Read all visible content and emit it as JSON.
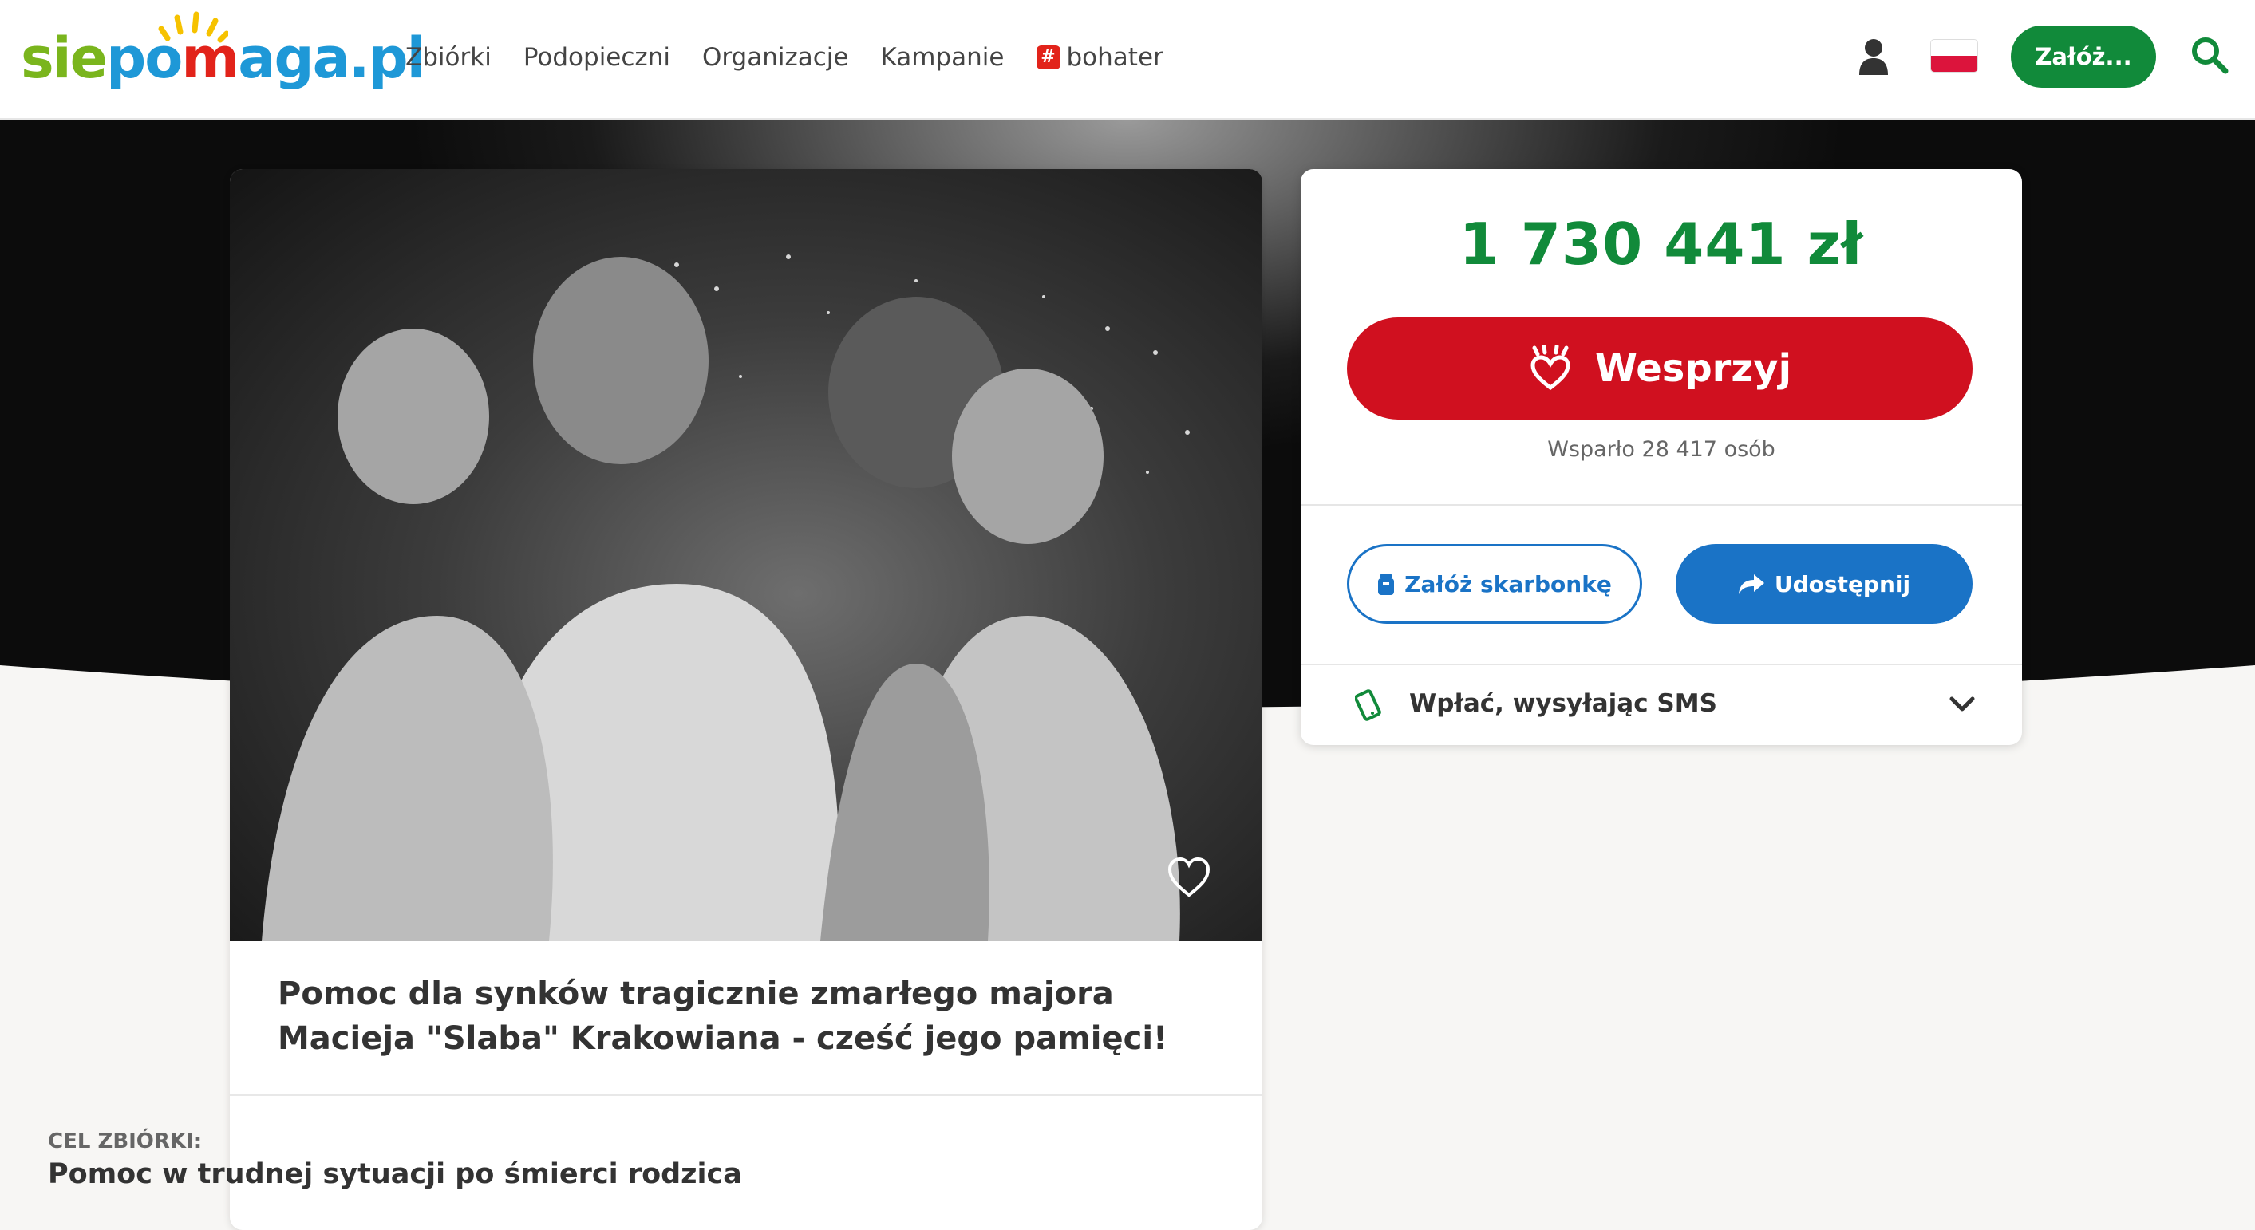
{
  "header": {
    "logo": {
      "sie": "sie",
      "po": "po",
      "heart": "m",
      "maga": "aga",
      "pl": ".pl"
    },
    "nav": [
      "Zbiórki",
      "Podopieczni",
      "Organizacje",
      "Kampanie"
    ],
    "nav_hashtag": {
      "badge": "#",
      "label": "bohater"
    },
    "cta_label": "Załóż...",
    "icons": [
      "user-icon",
      "poland-flag-icon",
      "search-icon"
    ]
  },
  "fundraiser": {
    "title": "Pomoc dla synków tragicznie zmarłego majora Macieja \"Slaba\" Krakowiana - cześć jego pamięci!",
    "goal_label": "CEL ZBIÓRKI:",
    "goal_value": "Pomoc w trudnej sytuacji po śmierci rodzica"
  },
  "donation": {
    "amount": "1 730 441 zł",
    "support_button": "Wesprzyj",
    "supporters": "Wsparło 28 417 osób",
    "piggybank_button": "Załóż skarbonkę",
    "share_button": "Udostępnij",
    "sms_label": "Wpłać, wysyłając SMS"
  },
  "colors": {
    "brand_green": "#118a3a",
    "support_red": "#d0101f",
    "action_blue": "#1a73c6"
  }
}
